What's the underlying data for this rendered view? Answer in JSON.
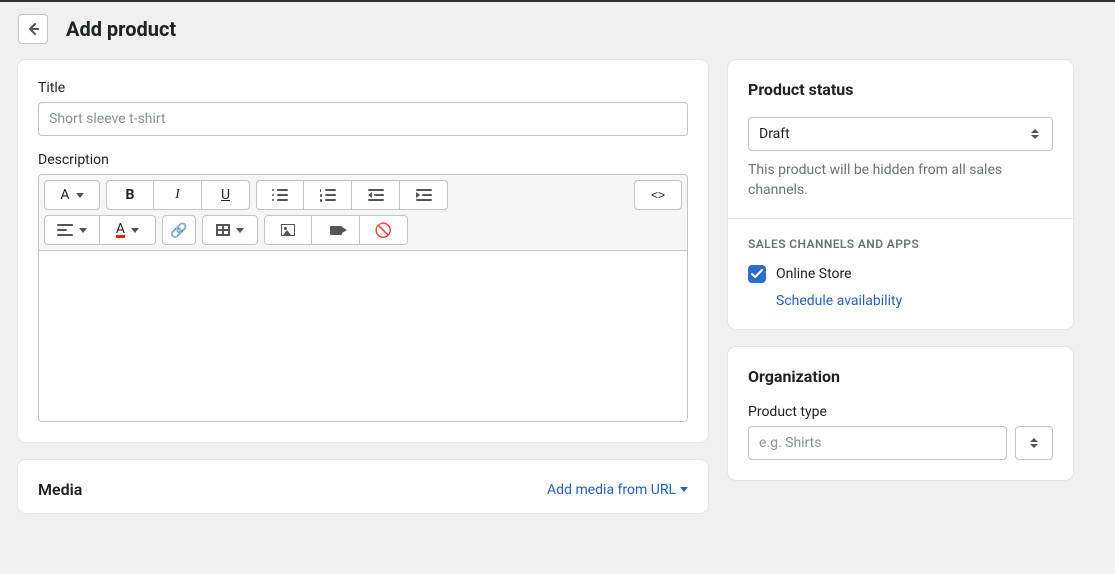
{
  "header": {
    "page_title": "Add product"
  },
  "main": {
    "title_label": "Title",
    "title_placeholder": "Short sleeve t-shirt",
    "title_value": "",
    "description_label": "Description",
    "editor": {
      "font_button": "A",
      "bold": "B",
      "italic": "I",
      "underline": "U",
      "text_color": "A",
      "code_view": "<>"
    }
  },
  "media": {
    "title": "Media",
    "add_link": "Add media from URL"
  },
  "status": {
    "title": "Product status",
    "value": "Draft",
    "help": "This product will be hidden from all sales channels.",
    "channels_heading": "SALES CHANNELS AND APPS",
    "online_store_label": "Online Store",
    "online_store_checked": true,
    "schedule_link": "Schedule availability"
  },
  "organization": {
    "title": "Organization",
    "product_type_label": "Product type",
    "product_type_placeholder": "e.g. Shirts",
    "product_type_value": ""
  }
}
